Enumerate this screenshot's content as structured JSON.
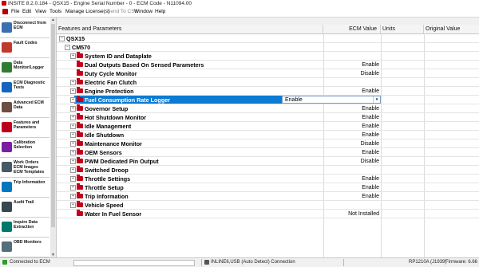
{
  "window": {
    "title": "INSITE 8.2.0.184 - QSX15 - Engine Serial Number - 0 - ECM Code - N11094.00"
  },
  "menu": [
    {
      "label": "File",
      "disabled": false
    },
    {
      "label": "Edit",
      "disabled": false
    },
    {
      "label": "View",
      "disabled": false
    },
    {
      "label": "Tools",
      "disabled": false
    },
    {
      "label": "Manage License(s)",
      "disabled": false
    },
    {
      "label": "Send To CSS",
      "disabled": true
    },
    {
      "label": "Window",
      "disabled": false
    },
    {
      "label": "Help",
      "disabled": false
    }
  ],
  "nav": [
    {
      "label": "Disconnect from\nECM",
      "icon": "disconnect-icon",
      "color": "#3a6fb0"
    },
    {
      "label": "Fault Codes",
      "icon": "fault-codes-icon",
      "color": "#c0392b"
    },
    {
      "label": "Data\nMonitor/Logger",
      "icon": "data-monitor-icon",
      "color": "#2e7d32"
    },
    {
      "label": "ECM Diagnostic\nTests",
      "icon": "diagnostic-tests-icon",
      "color": "#1565c0"
    },
    {
      "label": "Advanced ECM\nData",
      "icon": "advanced-data-icon",
      "color": "#6d4c41"
    },
    {
      "label": "Features and\nParameters",
      "icon": "features-icon",
      "color": "#c0001a"
    },
    {
      "label": "Calibration\nSelection",
      "icon": "calibration-icon",
      "color": "#7b1fa2"
    },
    {
      "label": "Work Orders\nECM Images\nECM Templates",
      "icon": "work-orders-icon",
      "color": "#455a64"
    },
    {
      "label": "Trip Information",
      "icon": "trip-info-icon",
      "color": "#0277bd"
    },
    {
      "label": "Audit Trail",
      "icon": "audit-trail-icon",
      "color": "#37474f"
    },
    {
      "label": "Inquire Data\nExtraction",
      "icon": "inquire-icon",
      "color": "#00796b"
    },
    {
      "label": "OBD Monitors",
      "icon": "obd-icon",
      "color": "#546e7a"
    }
  ],
  "grid": {
    "headers": {
      "name": "Features and Parameters",
      "ecm_value": "ECM Value",
      "units": "Units",
      "original": "Original Value"
    },
    "root": {
      "label": "QSX15",
      "expander": "−"
    },
    "group": {
      "label": "CM570",
      "expander": "−"
    },
    "rows": [
      {
        "label": "System ID and Dataplate",
        "value": "",
        "expander": "+"
      },
      {
        "label": "Dual Outputs Based On Sensed Parameters",
        "value": "Enable",
        "expander": ""
      },
      {
        "label": "Duty Cycle Monitor",
        "value": "Disable",
        "expander": ""
      },
      {
        "label": "Electric Fan Clutch",
        "value": "",
        "expander": "+"
      },
      {
        "label": "Engine Protection",
        "value": "Enable",
        "expander": "+"
      },
      {
        "label": "Fuel Consumption Rate Logger",
        "value": "Enable",
        "expander": "+",
        "selected": true
      },
      {
        "label": "Governor Setup",
        "value": "Enable",
        "expander": "+"
      },
      {
        "label": "Hot Shutdown Monitor",
        "value": "Enable",
        "expander": "+"
      },
      {
        "label": "Idle Management",
        "value": "Enable",
        "expander": "+"
      },
      {
        "label": "Idle Shutdown",
        "value": "Enable",
        "expander": "+"
      },
      {
        "label": "Maintenance Monitor",
        "value": "Disable",
        "expander": "+"
      },
      {
        "label": "OEM Sensors",
        "value": "Enable",
        "expander": "+"
      },
      {
        "label": "PWM Dedicated Pin Output",
        "value": "Disable",
        "expander": "+"
      },
      {
        "label": "Switched Droop",
        "value": "",
        "expander": "+"
      },
      {
        "label": "Throttle Settings",
        "value": "Enable",
        "expander": "+"
      },
      {
        "label": "Throttle Setup",
        "value": "Enable",
        "expander": "+"
      },
      {
        "label": "Trip Information",
        "value": "Enable",
        "expander": "+"
      },
      {
        "label": "Vehicle Speed",
        "value": "",
        "expander": "+"
      },
      {
        "label": "Water In Fuel Sensor",
        "value": "Not Installed",
        "expander": ""
      }
    ],
    "dropdown_arrow": "▾"
  },
  "status": {
    "connection": "Connected to ECM",
    "adapter": "INLINE6,USB (Auto Detect) Connection",
    "protocol": "RP1210A (J1939)",
    "firmware": "Firmware: 6.66"
  }
}
